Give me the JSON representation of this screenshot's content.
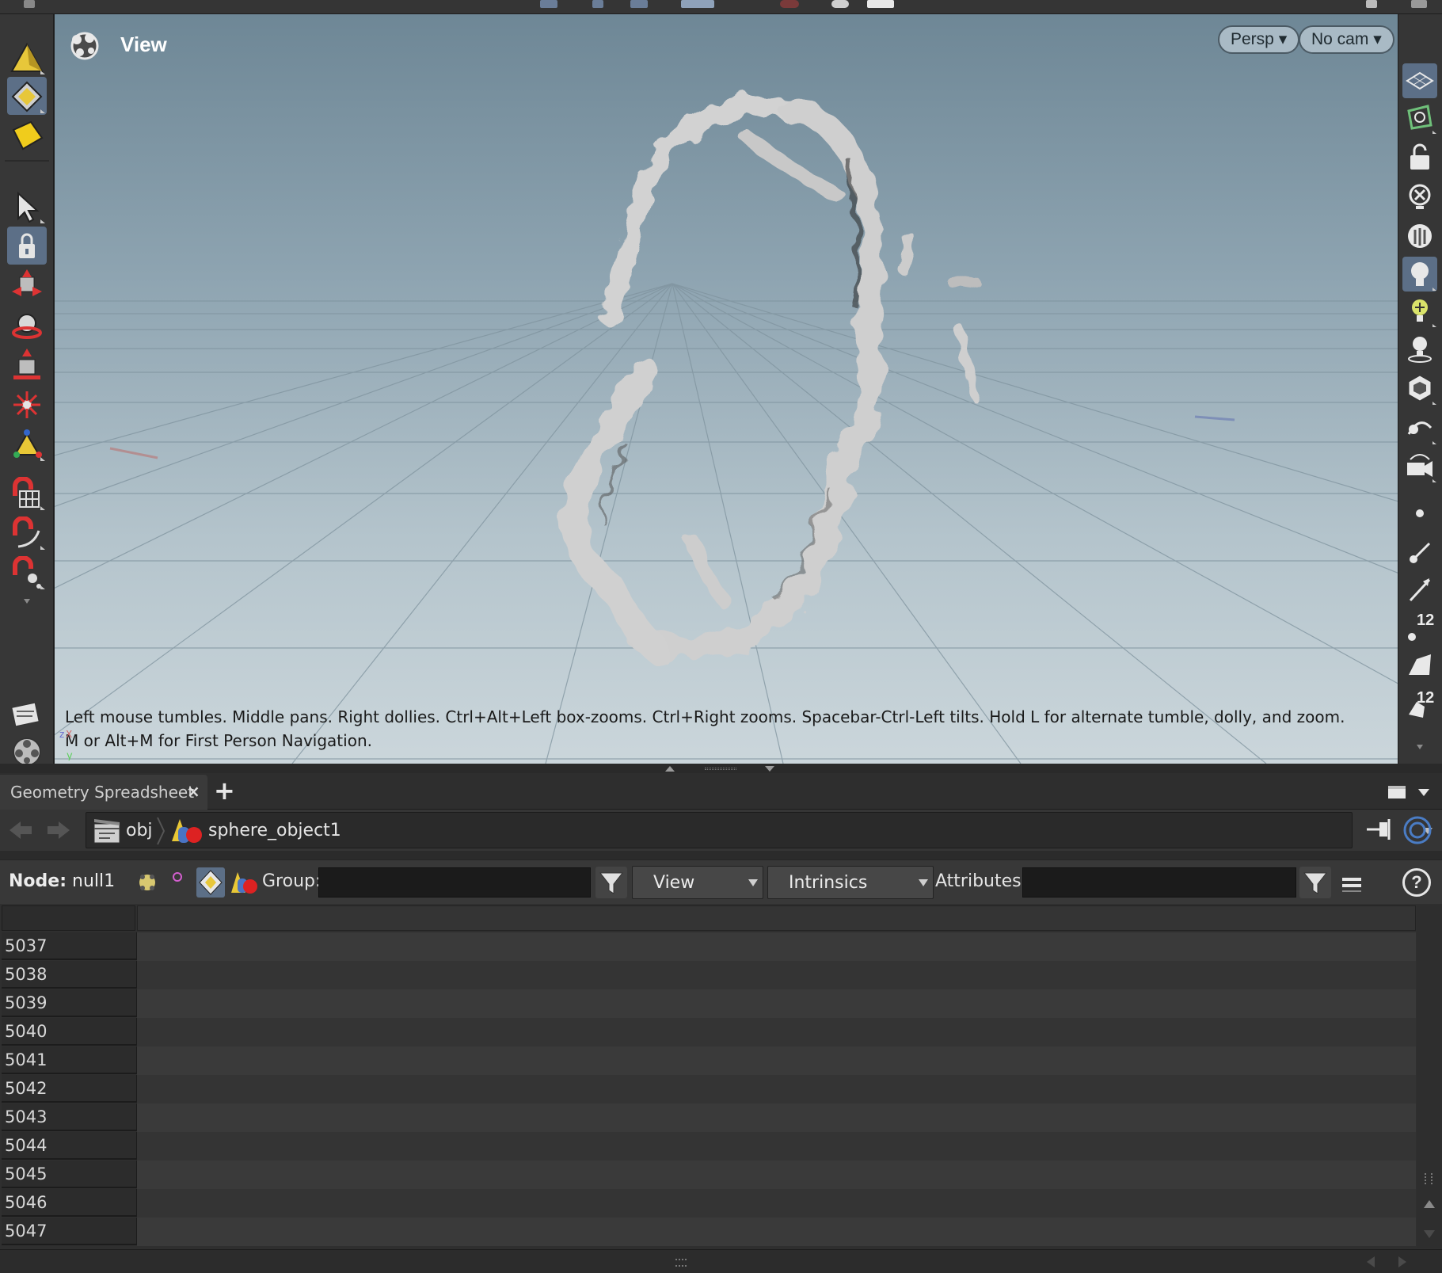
{
  "viewport": {
    "title": "View",
    "projection": "Persp",
    "camera": "No cam",
    "hint": "Left mouse tumbles. Middle pans. Right dollies. Ctrl+Alt+Left box-zooms. Ctrl+Right zooms. Spacebar-Ctrl-Left tilts. Hold L for alternate tumble, dolly, and zoom. M or Alt+M for First Person Navigation.",
    "axis": {
      "x": "X",
      "y": "y",
      "z": "z"
    },
    "badges": {
      "b1": "12",
      "b2": "12"
    }
  },
  "pane": {
    "tab_label": "Geometry Spreadsheet",
    "close": "×",
    "add": "+"
  },
  "path": {
    "items": [
      "obj",
      "sphere_object1"
    ]
  },
  "options": {
    "node_key": "Node:",
    "node_value": "null1",
    "group_label": "Group:",
    "group_value": "",
    "view_combo": "View",
    "intrinsics_combo": "Intrinsics",
    "attributes_label": "Attributes:",
    "attributes_value": "",
    "help": "?"
  },
  "table": {
    "rows": [
      "5037",
      "5038",
      "5039",
      "5040",
      "5041",
      "5042",
      "5043",
      "5044",
      "5045",
      "5046",
      "5047"
    ]
  },
  "icons": {
    "left_shelf": [
      "create-geometry-icon",
      "handle-mode-icon",
      "object-level-icon",
      "select-icon",
      "lock-pose-icon",
      "transform-icon",
      "rotate-icon",
      "scale-icon",
      "pose-icon",
      "handle-icon",
      "snap-grid-icon",
      "snap-primitive-icon",
      "snap-point-icon",
      "render-region-icon",
      "flipbook-icon"
    ],
    "right_shelf": [
      "construction-plane-icon",
      "reference-plane-icon",
      "lock-camera-icon",
      "ghost-icon",
      "shading-icon",
      "headlight-icon",
      "light-add-icon",
      "light-icon",
      "geometry-icon",
      "camera-link-icon",
      "camera-icon",
      "point-display-icon",
      "normal-icon",
      "vector-icon",
      "point-number-icon",
      "primitive-icon",
      "primitive-number-icon"
    ]
  },
  "colors": {
    "selected_tool": "#5c6f87",
    "viewport_top": "#6e8796",
    "viewport_bottom": "#cbd6db",
    "geometry": "#cfcfcf"
  }
}
